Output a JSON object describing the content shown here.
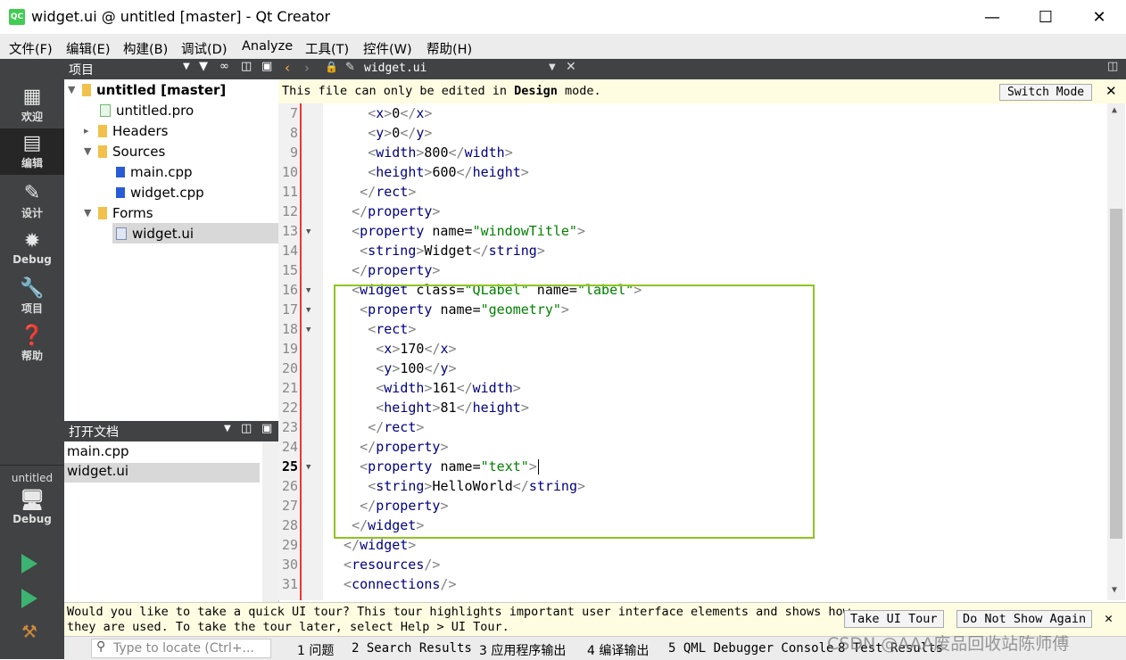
{
  "window": {
    "title": "widget.ui @ untitled [master] - Qt Creator",
    "logo": "QC"
  },
  "menu": [
    "文件(F)",
    "编辑(E)",
    "构建(B)",
    "调试(D)",
    "Analyze",
    "工具(T)",
    "控件(W)",
    "帮助(H)"
  ],
  "modes": [
    {
      "icon": "grid-icon",
      "label": "欢迎"
    },
    {
      "icon": "edit-icon",
      "label": "编辑"
    },
    {
      "icon": "pencil-icon",
      "label": "设计"
    },
    {
      "icon": "bug-icon",
      "label": "Debug"
    },
    {
      "icon": "wrench-icon",
      "label": "项目"
    },
    {
      "icon": "help-icon",
      "label": "帮助"
    }
  ],
  "kit": {
    "project": "untitled",
    "label": "Debug"
  },
  "project_panel": {
    "title": "项目",
    "tree": [
      {
        "label": "untitled [master]",
        "bold": true
      },
      {
        "label": "untitled.pro"
      },
      {
        "label": "Headers"
      },
      {
        "label": "Sources"
      },
      {
        "label": "main.cpp"
      },
      {
        "label": "widget.cpp"
      },
      {
        "label": "Forms"
      },
      {
        "label": "widget.ui"
      }
    ]
  },
  "open_docs": {
    "title": "打开文档",
    "items": [
      "main.cpp",
      "widget.ui"
    ]
  },
  "editor": {
    "tab": "widget.ui",
    "info_pre": "This file can only be edited in ",
    "info_bold": "Design",
    "info_post": " mode.",
    "switch_mode": "Switch Mode",
    "lines": [
      {
        "n": "7",
        "t": "<x>0</x>"
      },
      {
        "n": "8",
        "t": "<y>0</y>"
      },
      {
        "n": "9",
        "t": "<width>800</width>"
      },
      {
        "n": "10",
        "t": "<height>600</height>"
      },
      {
        "n": "11",
        "t": "</rect>"
      },
      {
        "n": "12",
        "t": "</property>"
      },
      {
        "n": "13",
        "t": "<property name=\"windowTitle\">"
      },
      {
        "n": "14",
        "t": "<string>Widget</string>"
      },
      {
        "n": "15",
        "t": "</property>"
      },
      {
        "n": "16",
        "t": "<widget class=\"QLabel\" name=\"label\">"
      },
      {
        "n": "17",
        "t": "<property name=\"geometry\">"
      },
      {
        "n": "18",
        "t": "<rect>"
      },
      {
        "n": "19",
        "t": "<x>170</x>"
      },
      {
        "n": "20",
        "t": "<y>100</y>"
      },
      {
        "n": "21",
        "t": "<width>161</width>"
      },
      {
        "n": "22",
        "t": "<height>81</height>"
      },
      {
        "n": "23",
        "t": "</rect>"
      },
      {
        "n": "24",
        "t": "</property>"
      },
      {
        "n": "25",
        "t": "<property name=\"text\">"
      },
      {
        "n": "26",
        "t": "<string>HelloWorld</string>"
      },
      {
        "n": "27",
        "t": "</property>"
      },
      {
        "n": "28",
        "t": "</widget>"
      },
      {
        "n": "29",
        "t": "</widget>"
      },
      {
        "n": "30",
        "t": "<resources/>"
      },
      {
        "n": "31",
        "t": "<connections/>"
      }
    ]
  },
  "tour": {
    "text_line1": "Would you like to take a quick UI tour? This tour highlights important user interface elements and shows how",
    "text_line2": "they are used. To take the tour later, select Help > UI Tour.",
    "take_tour": "Take UI Tour",
    "dont_show": "Do Not Show Again"
  },
  "status": {
    "locate_placeholder": "Type to locate (Ctrl+...",
    "items": [
      "1 问题",
      "2 Search Results",
      "3 应用程序输出",
      "4 编译输出",
      "5 QML Debugger Console",
      "8 Test Results"
    ],
    "watermark": "CSDN @AAA废品回收站陈师傅"
  },
  "colors": {
    "highlight_box": "#90c320",
    "dark_panel": "#404244",
    "info_bg": "#fffde1"
  }
}
